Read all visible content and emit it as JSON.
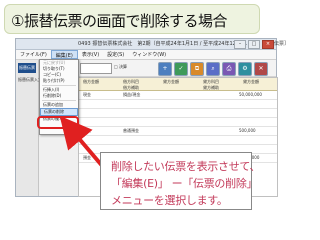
{
  "title": "①振替伝票の画面で削除する場合",
  "app": {
    "window_title": "0493 振替伝票株式会社　第2期（自平成24年1月1日 / 至平成24年12月31日）-［振替伝票］",
    "menu": [
      "ファイル(F)",
      "編集(E)",
      "表示(V)",
      "設定(S)",
      "ウィンドウ(W)"
    ],
    "logo": "振替伝票",
    "left_label": "振替伝票入力",
    "dropdown_items": [
      "元に戻す(U)",
      "切り取り(T)",
      "コピー(C)",
      "貼り付け(P)",
      "行挿入(I)",
      "行削除(D)",
      "伝票の追加",
      "伝票の削除",
      "伝票の複写"
    ],
    "toolbar_check": "□ 決算",
    "grid": {
      "head_row1": [
        "借方金額",
        "借方科目",
        "貸方金額",
        "貸方科目",
        "貸方金額"
      ],
      "head_row2": [
        "",
        "借方補助",
        "",
        "貸方補助",
        ""
      ],
      "rows": [
        {
          "account": "現金",
          "desc": "損益/現金",
          "amount": "50,000,000"
        },
        {
          "account": "",
          "desc": "",
          "amount": ""
        },
        {
          "account": "",
          "desc": "",
          "amount": ""
        },
        {
          "account": "",
          "desc": "",
          "amount": ""
        },
        {
          "account": "預金",
          "desc": "普通預金",
          "amount": "500,000"
        },
        {
          "account": "",
          "desc": "",
          "amount": ""
        },
        {
          "account": "",
          "desc": "",
          "amount": ""
        },
        {
          "account": "預金",
          "desc": "当座預金",
          "amount": "1,000,000"
        }
      ]
    }
  },
  "callout": {
    "line1": "削除したい伝票を表示させて、",
    "line2": "「編集(E)」 ー「伝票の削除」",
    "line3": "メニューを選択します。"
  },
  "colors": {
    "accent_red": "#e02020",
    "callout_text": "#c33a5a",
    "title_bg": "#eef3e0"
  }
}
